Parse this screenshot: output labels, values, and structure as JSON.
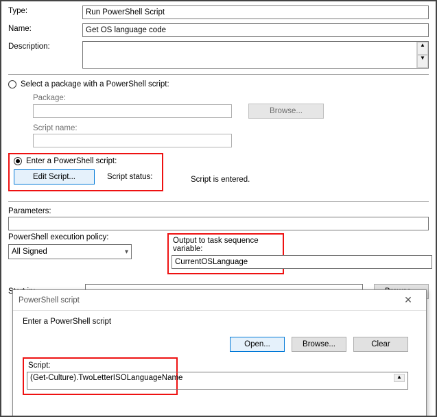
{
  "fields": {
    "type_label": "Type:",
    "type_value": "Run PowerShell Script",
    "name_label": "Name:",
    "name_value": "Get OS language code",
    "description_label": "Description:",
    "description_value": ""
  },
  "radio": {
    "select_pkg_label": "Select a package with a PowerShell script:",
    "enter_script_label": "Enter a PowerShell script:"
  },
  "pkg": {
    "package_label": "Package:",
    "package_value": "",
    "browse_label": "Browse...",
    "scriptname_label": "Script name:",
    "scriptname_value": ""
  },
  "enter": {
    "edit_button": "Edit Script...",
    "status_label": "Script status:",
    "status_value": "Script is entered."
  },
  "params": {
    "label": "Parameters:",
    "value": ""
  },
  "policy": {
    "label": "PowerShell execution policy:",
    "value": "All Signed",
    "output_label": "Output to task sequence variable:",
    "output_value": "CurrentOSLanguage"
  },
  "startin": {
    "label": "Start in:",
    "value": "",
    "browse": "Browse..."
  },
  "dialog": {
    "title": "PowerShell script",
    "prompt": "Enter a PowerShell script",
    "open": "Open...",
    "browse": "Browse...",
    "clear": "Clear",
    "script_label": "Script:",
    "script_value": "(Get-Culture).TwoLetterISOLanguageName"
  }
}
